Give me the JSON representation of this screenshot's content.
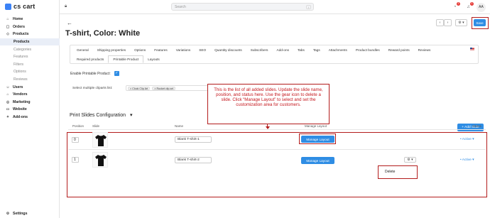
{
  "app": {
    "logo": "cs cart"
  },
  "sidebar": {
    "items": [
      {
        "label": "Home",
        "icon": "home-icon",
        "glyph": "⌂"
      },
      {
        "label": "Orders",
        "icon": "orders-icon",
        "glyph": "▢"
      },
      {
        "label": "Products",
        "icon": "products-icon",
        "glyph": "◇"
      },
      {
        "label": "Products",
        "sub": true,
        "active": true
      },
      {
        "label": "Categories",
        "sub": true
      },
      {
        "label": "Features",
        "sub": true
      },
      {
        "label": "Filters",
        "sub": true
      },
      {
        "label": "Options",
        "sub": true
      },
      {
        "label": "Reviews",
        "sub": true
      },
      {
        "label": "Users",
        "icon": "users-icon",
        "glyph": "☺"
      },
      {
        "label": "Vendors",
        "icon": "vendors-icon",
        "glyph": "⌂"
      },
      {
        "label": "Marketing",
        "icon": "marketing-icon",
        "glyph": "◎"
      },
      {
        "label": "Website",
        "icon": "website-icon",
        "glyph": "▭"
      },
      {
        "label": "Add-ons",
        "icon": "addons-icon",
        "glyph": "✦"
      }
    ],
    "settings": "Settings"
  },
  "topbar": {
    "search_placeholder": "Search",
    "search_shortcut": "/",
    "avatar": "AA",
    "notifications_badge": "2",
    "alerts_badge": "1"
  },
  "page": {
    "back": "←",
    "title": "T-shirt, Color: White",
    "save_label": "Save",
    "prev": "‹",
    "next": "›",
    "gear": "⚙ ▾"
  },
  "tabs_row1": [
    "General",
    "Shipping properties",
    "Options",
    "Features",
    "Variations",
    "SEO",
    "Quantity discounts",
    "Subscribers",
    "Add-ons",
    "Tabs",
    "Tags",
    "Attachments",
    "Product bundles",
    "Reward points",
    "Reviews"
  ],
  "tabs_row2": [
    "Required products",
    "Printable Product",
    "Layouts"
  ],
  "form": {
    "enable_label": "Enable Printable Product:",
    "clipart_label": "Select multiple cliparts list:",
    "cliparts": [
      "× Clock Clip Art",
      "× Rocket clip art"
    ]
  },
  "callout": "This is the list of all added slides. Update the slide name, position, and status here. Use the gear icon to delete a slide. Click “Manage Layout” to select and set the customization area for customers.",
  "section": {
    "title": "Print Slides Configuration",
    "caret": "▾",
    "add_button": "+ Add Slide"
  },
  "table": {
    "headers": {
      "position": "Position",
      "slide": "Slide",
      "name": "Name",
      "manage": "Manage Layout",
      "status": "Status"
    },
    "rows": [
      {
        "position": "0",
        "name": "Blank T-shirt-1",
        "manage": "Manage Layout",
        "status": "• Active ▾"
      },
      {
        "position": "1",
        "name": "Blank T-shirt-2",
        "manage": "Manage Layout",
        "status": "• Active ▾"
      }
    ],
    "delete_label": "Delete"
  },
  "colors": {
    "accent": "#2f8de4",
    "highlight": "#b31c1c"
  }
}
